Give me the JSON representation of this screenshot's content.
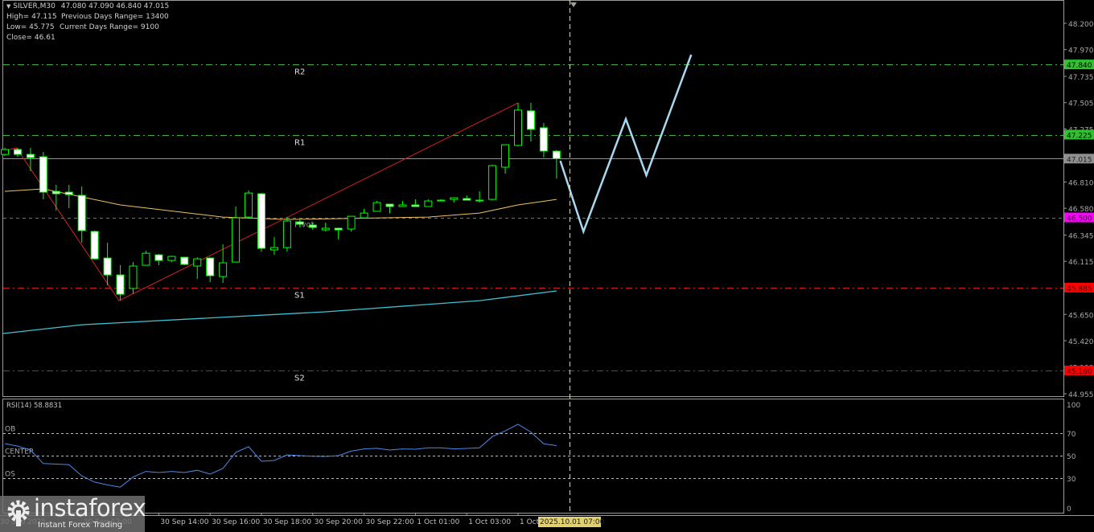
{
  "header": {
    "symbol": "SILVER,M30",
    "ohlc": "47.080 47.090 46.840 47.015",
    "high": "High= 47.115",
    "prev_range": "Previous Days Range= 13400",
    "low": "Low= 45.775",
    "cur_range": "Current Days Range= 9100",
    "close": "Close= 46.61"
  },
  "colors": {
    "bull": "#00ff00",
    "bear_fill": "#ffffff",
    "ma_fast": "#f0c060",
    "ma_slow": "#40c0d0",
    "trend": "#d02020",
    "forecast": "#a8d8f0",
    "rsi": "#4a8ae8"
  },
  "chart_data": {
    "type": "candlestick",
    "price_axis": {
      "range": [
        44.955,
        48.2
      ],
      "ticks": [
        "48.200",
        "47.970",
        "47.735",
        "47.505",
        "47.275",
        "47.040",
        "46.810",
        "46.580",
        "46.345",
        "46.115",
        "45.650",
        "45.420",
        "45.190",
        "44.955"
      ]
    },
    "time_axis": {
      "labels": [
        "30 Sep 2025",
        "30 Sep 12:00",
        "30 Sep 14:00",
        "30 Sep 16:00",
        "30 Sep 18:00",
        "30 Sep 20:00",
        "30 Sep 22:00",
        "1 Oct 01:00",
        "1 Oct 03:00",
        "1 Oct"
      ],
      "label_candle_index": [
        -0.5,
        6,
        12,
        16,
        20,
        24,
        28,
        32,
        36,
        40
      ],
      "cursor_label": "2025.10.01 07:00"
    },
    "candles": [
      [
        47.052,
        47.109,
        47.038,
        47.095
      ],
      [
        47.095,
        47.109,
        47.031,
        47.052
      ],
      [
        47.052,
        47.109,
        46.905,
        47.024
      ],
      [
        47.031,
        47.073,
        46.658,
        46.721
      ],
      [
        46.728,
        46.785,
        46.56,
        46.707
      ],
      [
        46.721,
        46.785,
        46.581,
        46.7
      ],
      [
        46.693,
        46.771,
        46.278,
        46.384
      ],
      [
        46.377,
        46.384,
        46.13,
        46.137
      ],
      [
        46.144,
        46.278,
        45.905,
        45.996
      ],
      [
        45.996,
        46.081,
        45.771,
        45.827
      ],
      [
        45.877,
        46.109,
        45.83,
        46.074
      ],
      [
        46.081,
        46.208,
        46.081,
        46.186
      ],
      [
        46.172,
        46.18,
        46.081,
        46.123
      ],
      [
        46.123,
        46.165,
        46.11,
        46.158
      ],
      [
        46.151,
        46.151,
        46.081,
        46.088
      ],
      [
        46.074,
        46.151,
        45.961,
        46.137
      ],
      [
        46.144,
        46.151,
        45.933,
        45.989
      ],
      [
        45.982,
        46.264,
        45.926,
        46.102
      ],
      [
        46.109,
        46.595,
        46.109,
        46.496
      ],
      [
        46.503,
        46.736,
        46.503,
        46.714
      ],
      [
        46.707,
        46.714,
        46.201,
        46.229
      ],
      [
        46.215,
        46.327,
        46.172,
        46.236
      ],
      [
        46.236,
        46.503,
        46.201,
        46.468
      ],
      [
        46.461,
        46.482,
        46.412,
        46.44
      ],
      [
        46.433,
        46.454,
        46.391,
        46.412
      ],
      [
        46.391,
        46.454,
        46.377,
        46.405
      ],
      [
        46.405,
        46.41,
        46.306,
        46.391
      ],
      [
        46.398,
        46.51,
        46.377,
        46.51
      ],
      [
        46.496,
        46.574,
        46.49,
        46.538
      ],
      [
        46.553,
        46.644,
        46.55,
        46.63
      ],
      [
        46.616,
        46.62,
        46.538,
        46.595
      ],
      [
        46.595,
        46.644,
        46.595,
        46.609
      ],
      [
        46.609,
        46.658,
        46.59,
        46.595
      ],
      [
        46.595,
        46.658,
        46.595,
        46.644
      ],
      [
        46.651,
        46.658,
        46.644,
        46.651
      ],
      [
        46.658,
        46.675,
        46.63,
        46.672
      ],
      [
        46.665,
        46.693,
        46.651,
        46.651
      ],
      [
        46.644,
        46.728,
        46.63,
        46.651
      ],
      [
        46.658,
        46.961,
        46.65,
        46.954
      ],
      [
        46.94,
        47.137,
        46.883,
        47.137
      ],
      [
        47.13,
        47.503,
        47.12,
        47.44
      ],
      [
        47.433,
        47.503,
        47.165,
        47.271
      ],
      [
        47.285,
        47.327,
        47.024,
        47.081
      ],
      [
        47.08,
        47.09,
        46.84,
        47.015
      ]
    ],
    "ma_fast": [
      [
        0,
        46.728
      ],
      [
        3,
        46.75
      ],
      [
        9,
        46.609
      ],
      [
        17,
        46.503
      ],
      [
        22,
        46.482
      ],
      [
        33,
        46.503
      ],
      [
        37,
        46.538
      ],
      [
        40,
        46.609
      ],
      [
        43,
        46.658
      ]
    ],
    "ma_slow": [
      [
        -0.2,
        45.482
      ],
      [
        6,
        45.56
      ],
      [
        25,
        45.673
      ],
      [
        37,
        45.771
      ],
      [
        43,
        45.856
      ]
    ],
    "trendline": [
      [
        0.1,
        47.088
      ],
      [
        0.9,
        47.109
      ],
      [
        8.9,
        45.771
      ],
      [
        40,
        47.503
      ]
    ],
    "forecast": [
      [
        43.3,
        46.996
      ],
      [
        45.1,
        46.376
      ],
      [
        48.4,
        47.362
      ],
      [
        50,
        46.869
      ],
      [
        53.5,
        47.925
      ]
    ],
    "levels": [
      {
        "name": "R2",
        "label": "R2",
        "price": 47.84,
        "badge": "47.840",
        "color": "#3cb43c",
        "badge_bg": "#30c030",
        "badge_fg": "#000000",
        "style": "dashdot"
      },
      {
        "name": "R1",
        "label": "R1",
        "price": 47.225,
        "badge": "47.225",
        "color": "#3cb43c",
        "badge_bg": "#30c030",
        "badge_fg": "#000000",
        "style": "dashdot"
      },
      {
        "name": "current",
        "label": "",
        "price": 47.015,
        "badge": "47.015",
        "color": "#909090",
        "badge_bg": "#909090",
        "badge_fg": "#202020",
        "style": "solid"
      },
      {
        "name": "Pivot",
        "label": "Pivot",
        "price": 46.5,
        "badge": "46.500",
        "color": "#d030d0",
        "badge_bg": "#ff00ff",
        "badge_fg": "#400040",
        "style": "dash"
      },
      {
        "name": "S1",
        "label": "S1",
        "price": 45.885,
        "badge": "45.885",
        "color": "#d01818",
        "badge_bg": "#ff0000",
        "badge_fg": "#400000",
        "style": "dashdot"
      },
      {
        "name": "S2",
        "label": "S2",
        "price": 45.16,
        "badge": "45.160",
        "color": "#d01818",
        "badge_bg": "#ff0000",
        "badge_fg": "#400000",
        "style": "dashdot"
      }
    ],
    "rsi": {
      "title": "RSI(14) 58.8831",
      "period": 14,
      "range": [
        0,
        100
      ],
      "ticks": [
        "100",
        "70",
        "50",
        "30",
        "0"
      ],
      "levels": [
        {
          "label": "OB",
          "value": 70
        },
        {
          "label": "CENTER",
          "value": 50
        },
        {
          "label": "OS",
          "value": 30
        }
      ],
      "values": [
        60.7,
        58.5,
        55,
        43,
        42.5,
        42,
        32,
        26.5,
        24,
        22,
        31,
        36,
        35,
        36,
        35,
        37,
        33.6,
        38.6,
        52.9,
        57.9,
        45,
        45.7,
        50.7,
        50,
        49.5,
        49.3,
        50,
        54,
        56,
        56.5,
        55,
        56,
        55.7,
        57,
        57,
        56,
        56.4,
        57,
        67,
        72,
        77.9,
        71,
        60.5,
        58.9
      ]
    }
  },
  "logo": {
    "name": "instaforex",
    "tagline": "Instant Forex Trading"
  }
}
